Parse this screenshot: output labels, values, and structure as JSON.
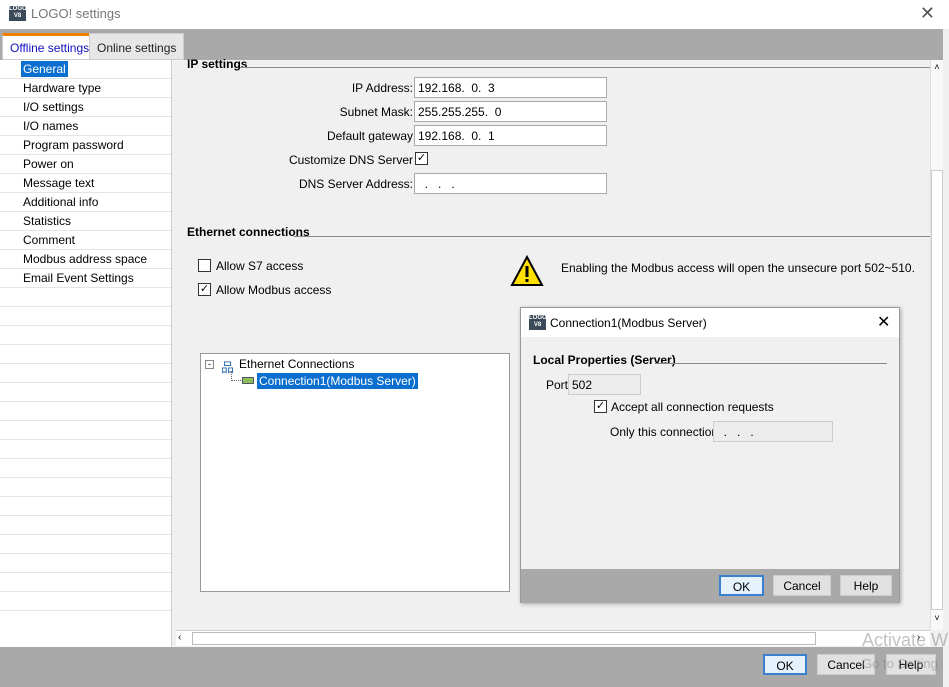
{
  "window": {
    "title": "LOGO! settings",
    "logo_text": "LOGO"
  },
  "tabs": [
    {
      "label": "Offline settings",
      "active": true
    },
    {
      "label": "Online settings",
      "active": false
    }
  ],
  "sidebar": {
    "items": [
      "General",
      "Hardware type",
      "I/O settings",
      "I/O names",
      "Program password",
      "Power on",
      "Message text",
      "Additional info",
      "Statistics",
      "Comment",
      "Modbus address space",
      "Email Event Settings"
    ],
    "selected": "General"
  },
  "ip": {
    "section": "IP settings",
    "ip_label": "IP Address:",
    "ip_value": "192.168.  0.  3",
    "mask_label": "Subnet Mask:",
    "mask_value": "255.255.255.  0",
    "gw_label": "Default gateway",
    "gw_value": "192.168.  0.  1",
    "dns_custom_label": "Customize DNS Server",
    "dns_custom_checked": true,
    "dns_label": "DNS Server Address:",
    "dns_value": "  .   .   ."
  },
  "ethernet": {
    "section": "Ethernet connections",
    "allow_s7_label": "Allow S7 access",
    "allow_s7_checked": false,
    "allow_modbus_label": "Allow Modbus access",
    "allow_modbus_checked": true,
    "warning": "Enabling the Modbus access will open the unsecure port 502~510.",
    "tree_root": "Ethernet Connections",
    "tree_child": "Connection1(Modbus Server)"
  },
  "dialog": {
    "title": "Connection1(Modbus Server)",
    "section": "Local Properties (Server)",
    "port_label": "Port:",
    "port_value": "502",
    "accept_label": "Accept all connection requests",
    "accept_checked": true,
    "only_label": "Only this connection:",
    "only_value": "  .   .   .",
    "ok": "OK",
    "cancel": "Cancel",
    "help": "Help"
  },
  "footer": {
    "ok": "OK",
    "cancel": "Cancel",
    "help": "Help"
  },
  "watermark": {
    "line1": "Activate W",
    "line2": "Go to Setting"
  },
  "colors": {
    "accent": "#0a6fcf",
    "tab_highlight": "#f08000"
  }
}
